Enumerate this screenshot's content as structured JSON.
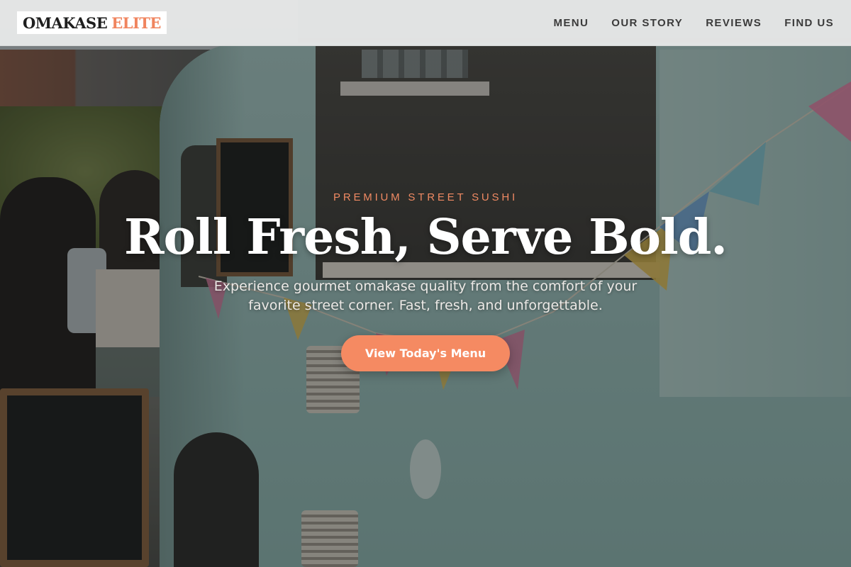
{
  "brand": {
    "name_main": "OMAKASE",
    "name_accent": "ELITE",
    "accent_color": "#f0845e"
  },
  "nav": {
    "items": [
      {
        "label": "MENU"
      },
      {
        "label": "OUR STORY"
      },
      {
        "label": "REVIEWS"
      },
      {
        "label": "FIND US"
      }
    ]
  },
  "hero": {
    "eyebrow": "PREMIUM STREET SUSHI",
    "headline": "Roll Fresh, Serve Bold.",
    "subtitle": "Experience gourmet omakase quality from the comfort of your favorite street corner. Fast, fresh, and unforgettable.",
    "cta_label": "View Today's Menu",
    "cta_color": "#f58a62"
  }
}
